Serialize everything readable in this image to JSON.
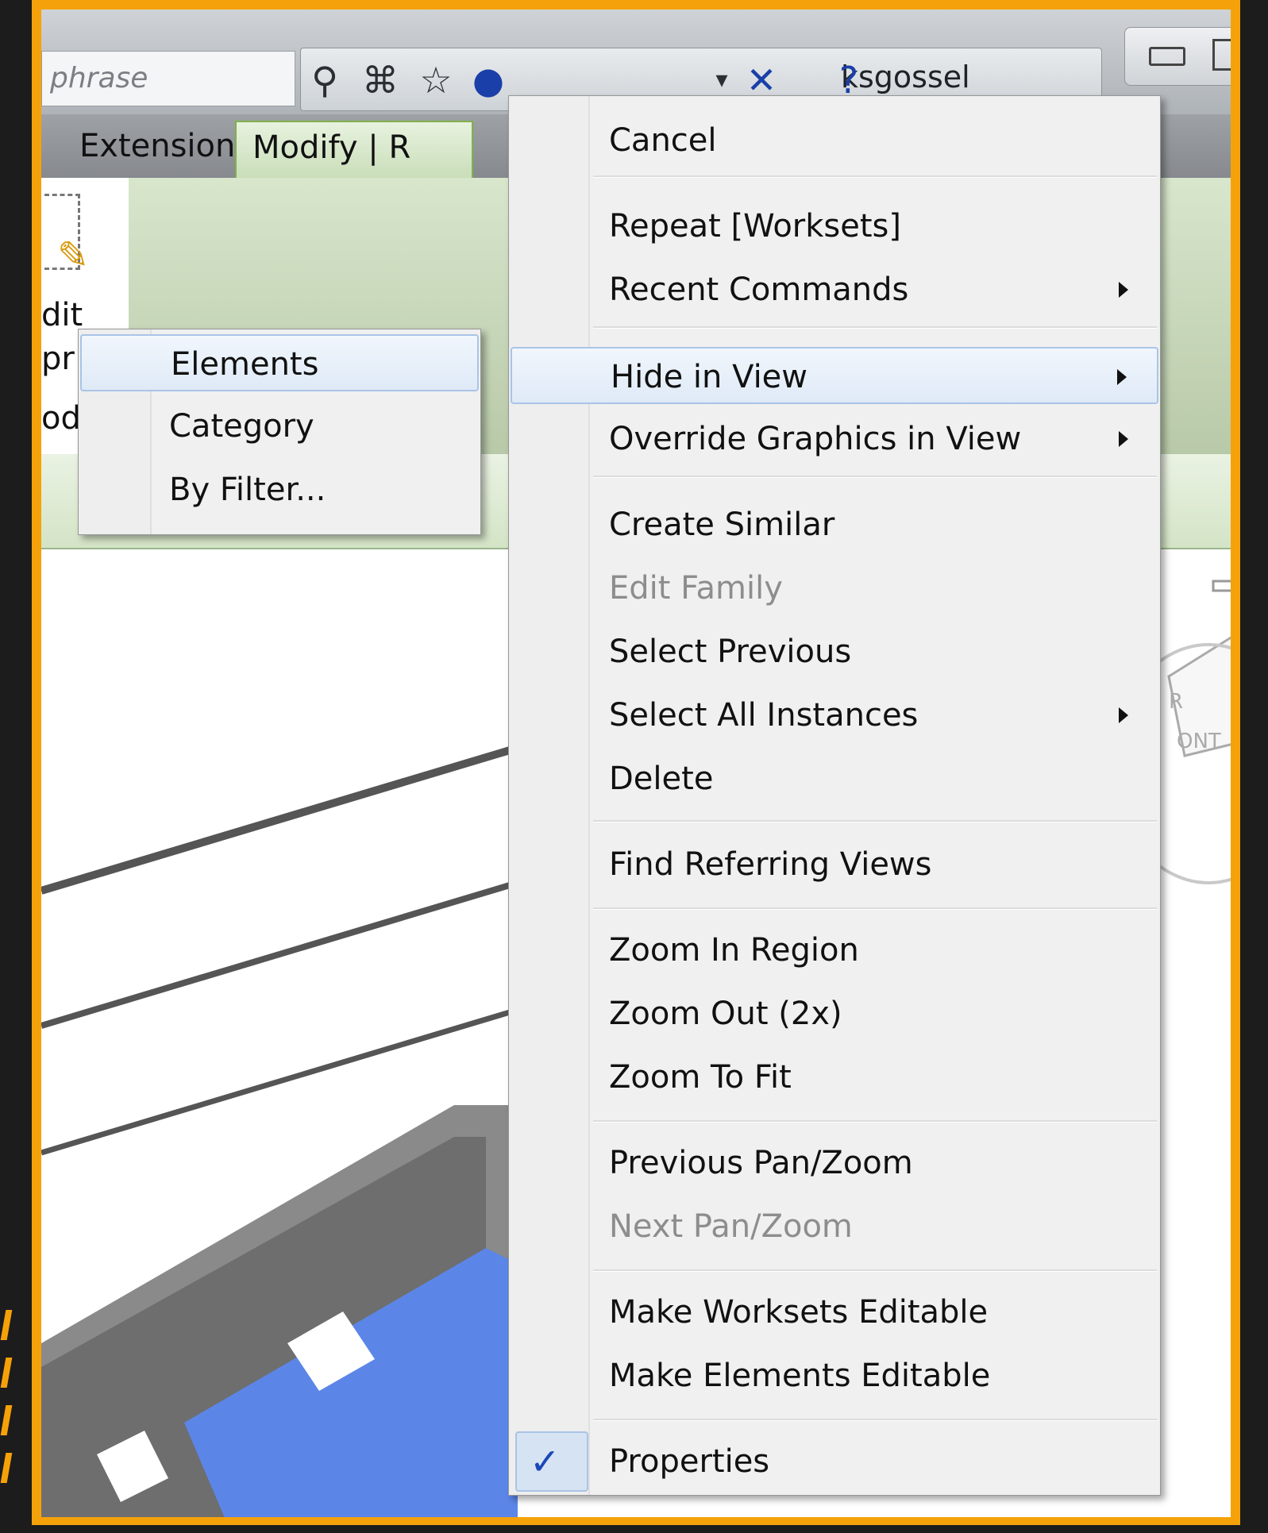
{
  "toolbar": {
    "search_placeholder": "phrase",
    "username": "ksgossel",
    "icons": [
      "binoculars-icon",
      "satellite-icon",
      "star-icon",
      "user-icon",
      "exchange-icon",
      "help-icon"
    ]
  },
  "ribbon": {
    "tabs": [
      {
        "label": "Extensions",
        "active": false
      },
      {
        "label": "Modify | R",
        "active": true
      }
    ],
    "panel_fragments": [
      "dit",
      "pr",
      "od"
    ]
  },
  "viewcube": {
    "labels": [
      "R",
      "ONT"
    ]
  },
  "context_menu": {
    "items": [
      {
        "label": "Cancel"
      },
      {
        "label": "Repeat [Worksets]"
      },
      {
        "label": "Recent Commands",
        "submenu": true
      },
      {
        "label": "Hide in View",
        "submenu": true,
        "highlighted": true
      },
      {
        "label": "Override Graphics in View",
        "submenu": true
      },
      {
        "label": "Create Similar"
      },
      {
        "label": "Edit Family",
        "disabled": true
      },
      {
        "label": "Select Previous"
      },
      {
        "label": "Select All Instances",
        "submenu": true
      },
      {
        "label": "Delete"
      },
      {
        "label": "Find Referring Views"
      },
      {
        "label": "Zoom In Region"
      },
      {
        "label": "Zoom Out (2x)"
      },
      {
        "label": "Zoom To Fit"
      },
      {
        "label": "Previous Pan/Zoom"
      },
      {
        "label": "Next Pan/Zoom",
        "disabled": true
      },
      {
        "label": "Make Worksets Editable"
      },
      {
        "label": "Make Elements Editable"
      },
      {
        "label": "Properties",
        "checked": true
      }
    ]
  },
  "submenu": {
    "items": [
      {
        "label": "Elements",
        "highlighted": true
      },
      {
        "label": "Category"
      },
      {
        "label": "By Filter..."
      }
    ]
  },
  "colors": {
    "frame": "#f5a20a",
    "ribbon_active": "#c9deb9",
    "highlight": "#a9c4e6",
    "selection": "#5b86e8"
  }
}
